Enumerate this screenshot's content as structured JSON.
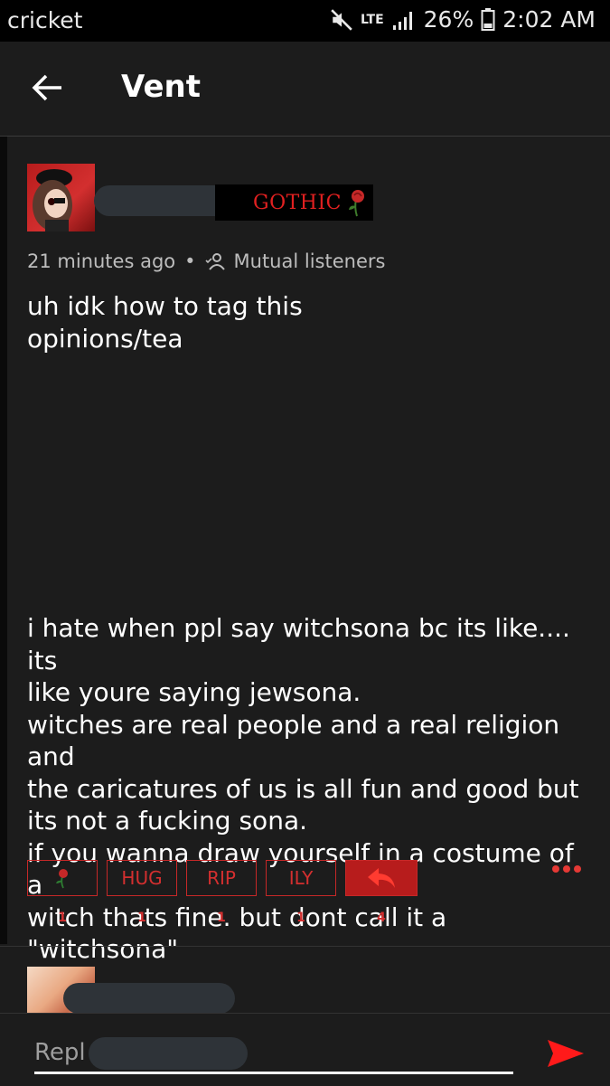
{
  "status_bar": {
    "carrier": "cricket",
    "network": "LTE",
    "battery": "26%",
    "time": "2:02 AM"
  },
  "header": {
    "title": "Vent",
    "back_icon": "arrow-left-icon"
  },
  "post": {
    "badge_text": "GOTHIC",
    "timestamp": "21 minutes ago",
    "separator": "•",
    "audience": "Mutual listeners",
    "title_lines": [
      "uh idk how to tag this",
      "opinions/tea"
    ],
    "body_lines": [
      "i hate when ppl say witchsona bc its like.... its",
      "like youre saying jewsona.",
      "witches are real people and a real religion and",
      "the caricatures of us is all fun and good but",
      "its not a fucking sona.",
      "if you wanna draw yourself in a costume of a",
      "witch thats fine. but dont call it a \"witchsona\""
    ],
    "reactions": [
      {
        "label": "",
        "icon": "wilted-rose-icon",
        "count": "1"
      },
      {
        "label": "HUG",
        "count": "1"
      },
      {
        "label": "RIP",
        "count": "1"
      },
      {
        "label": "ILY",
        "count": "1"
      },
      {
        "label": "",
        "icon": "reply-arrow-icon",
        "count": "4"
      }
    ]
  },
  "reply": {
    "placeholder": "Repl"
  },
  "colors": {
    "background": "#1c1c1c",
    "accent_red": "#d32f2f",
    "status_bar": "#000000"
  }
}
